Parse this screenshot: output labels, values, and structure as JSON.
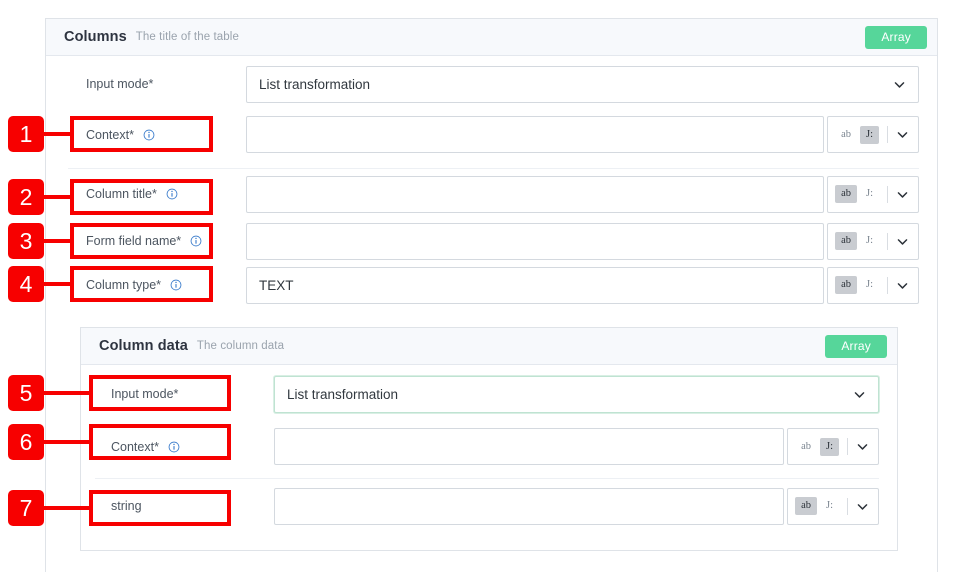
{
  "outer_panel": {
    "title": "Columns",
    "subtitle": "The title of the table",
    "badge": "Array",
    "badge_color": "#56d69a",
    "rows": [
      {
        "label": "Input mode*",
        "has_info": false,
        "control": "select",
        "value": "List transformation",
        "focused": false
      },
      {
        "label": "Context*",
        "has_info": true,
        "control": "input",
        "value": "",
        "mode_ab": "ab",
        "mode_json": "J:",
        "mode_selected": "json"
      },
      {
        "label": "Column title*",
        "has_info": true,
        "control": "input",
        "value": "",
        "mode_ab": "ab",
        "mode_json": "J:",
        "mode_selected": "ab"
      },
      {
        "label": "Form field name*",
        "has_info": true,
        "control": "input",
        "value": "",
        "mode_ab": "ab",
        "mode_json": "J:",
        "mode_selected": "ab"
      },
      {
        "label": "Column type*",
        "has_info": true,
        "control": "input",
        "value": "TEXT",
        "mode_ab": "ab",
        "mode_json": "J:",
        "mode_selected": "ab"
      }
    ]
  },
  "inner_panel": {
    "title": "Column data",
    "subtitle": "The column data",
    "badge": "Array",
    "badge_color": "#56d69a",
    "rows": [
      {
        "label": "Input mode*",
        "has_info": false,
        "control": "select",
        "value": "List transformation",
        "focused": true
      },
      {
        "label": "Context*",
        "has_info": true,
        "control": "input",
        "value": "",
        "mode_ab": "ab",
        "mode_json": "J:",
        "mode_selected": "json"
      },
      {
        "label": "string",
        "has_info": false,
        "control": "input",
        "value": "",
        "mode_ab": "ab",
        "mode_json": "J:",
        "mode_selected": "ab"
      }
    ]
  },
  "annotations": {
    "color": "#f70000",
    "markers": [
      {
        "number": "1",
        "target": "Context*"
      },
      {
        "number": "2",
        "target": "Column title*"
      },
      {
        "number": "3",
        "target": "Form field name*"
      },
      {
        "number": "4",
        "target": "Column type*"
      },
      {
        "number": "5",
        "target": "Input mode*"
      },
      {
        "number": "6",
        "target": "Context*"
      },
      {
        "number": "7",
        "target": "string"
      }
    ]
  }
}
